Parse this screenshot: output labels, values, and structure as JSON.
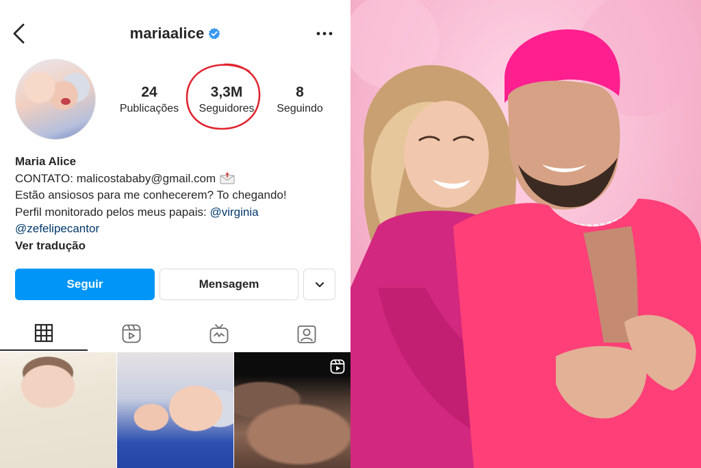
{
  "profile": {
    "username": "mariaalice",
    "verified": true,
    "stats": [
      {
        "value": "24",
        "label": "Publicações"
      },
      {
        "value": "3,3M",
        "label": "Seguidores"
      },
      {
        "value": "8",
        "label": "Seguindo"
      }
    ],
    "bio": {
      "name": "Maria Alice",
      "contact": "CONTATO: malicostababy@gmail.com",
      "line2": "Estão ansiosos para me conhecerem? To chegando!",
      "line3_prefix": "Perfil monitorado pelos meus papais: ",
      "mention1": "@virginia",
      "mention2": "@zefelipecantor",
      "translate": "Ver tradução"
    },
    "buttons": {
      "follow": "Seguir",
      "message": "Mensagem"
    },
    "tabs": [
      "grid-icon",
      "reels-icon",
      "igtv-icon",
      "tagged-icon"
    ],
    "posts": [
      {
        "type": "photo"
      },
      {
        "type": "photo"
      },
      {
        "type": "reel"
      }
    ]
  },
  "colors": {
    "follow_button": "#0095f6",
    "link": "#00376b",
    "verified_badge": "#3897f0",
    "highlight_circle": "#e0242f"
  }
}
